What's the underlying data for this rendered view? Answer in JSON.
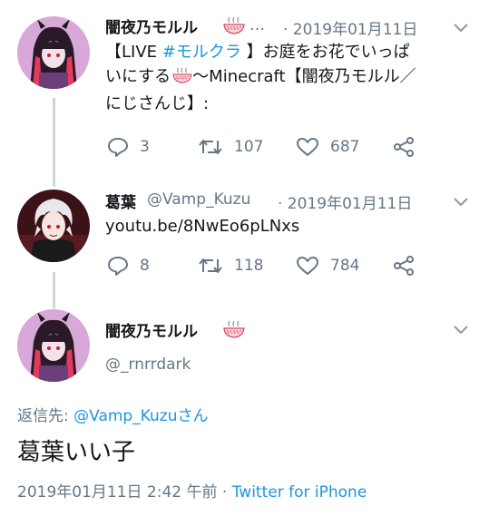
{
  "tweets": [
    {
      "display_name": "闇夜乃モルル",
      "ellipsis": "…",
      "date": "· 2019年01月11日",
      "text_line1_prefix": "【LIVE ",
      "hashtag": "#モルクラ",
      "text_line1_suffix": " 】お庭をお花でいっぱ",
      "text_line2_prefix": "いにする",
      "text_line2_suffix": "〜Minecraft【闇夜乃モルル／",
      "text_line3": "にじさんじ】:",
      "replies": "3",
      "retweets": "107",
      "likes": "687"
    },
    {
      "display_name": "葛葉",
      "handle": "@Vamp_Kuzu",
      "date": "· 2019年01月11日",
      "link": "youtu.be/8NwEo6pLNxs",
      "replies": "8",
      "retweets": "118",
      "likes": "784"
    }
  ],
  "main_tweet": {
    "display_name": "闇夜乃モルル",
    "handle": "@_rnrrdark",
    "reply_label": "返信先: ",
    "reply_handle": "@Vamp_Kuzuさん",
    "text": "葛葉いい子",
    "timestamp": "2019年01月11日 2:42 午前",
    "separator": "·",
    "source": "Twitter for iPhone"
  },
  "colors": {
    "link": "#1b95e0",
    "muted": "#657786",
    "thread_line": "#cdd6dd"
  }
}
